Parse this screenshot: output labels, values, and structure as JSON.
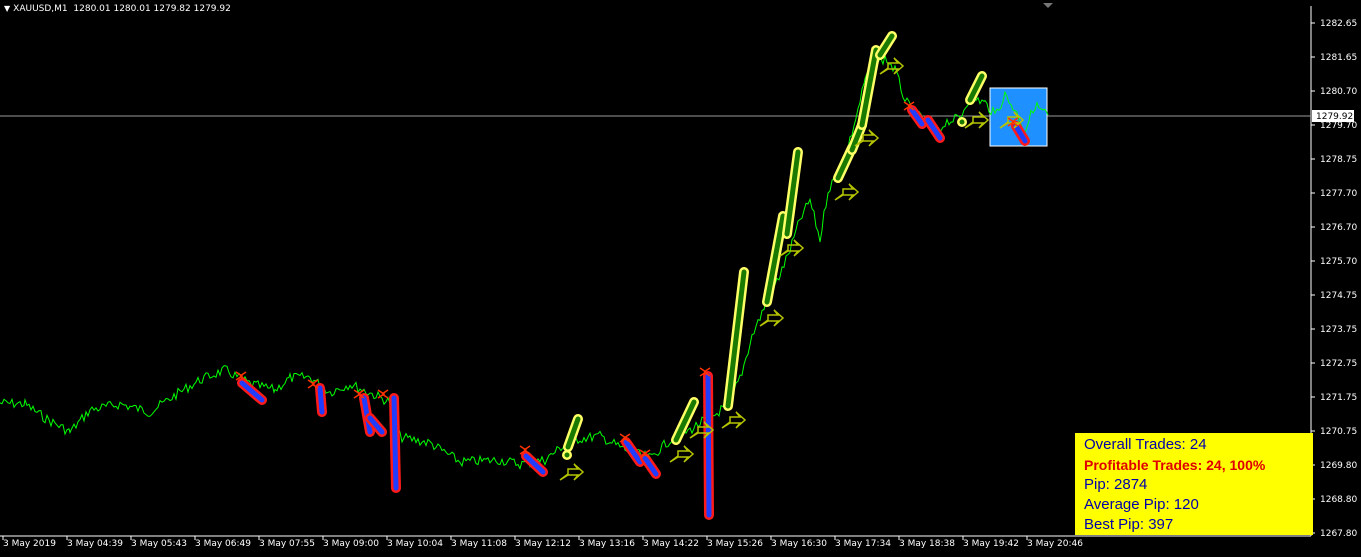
{
  "symbol": {
    "label": "XAUUSD,M1",
    "ohlc": "1280.01 1280.01 1279.82 1279.92"
  },
  "price_axis": {
    "ticks": [
      "1282.65",
      "1281.65",
      "1280.70",
      "1279.70",
      "1278.75",
      "1277.70",
      "1276.70",
      "1275.70",
      "1274.75",
      "1273.75",
      "1272.75",
      "1271.75",
      "1270.75",
      "1269.80",
      "1268.80",
      "1267.80"
    ],
    "current_price": "1279.92"
  },
  "time_axis": {
    "ticks": [
      "3 May 2019",
      "3 May 04:39",
      "3 May 05:43",
      "3 May 06:49",
      "3 May 07:55",
      "3 May 09:00",
      "3 May 10:04",
      "3 May 11:08",
      "3 May 12:12",
      "3 May 13:16",
      "3 May 14:22",
      "3 May 15:26",
      "3 May 16:30",
      "3 May 17:34",
      "3 May 18:38",
      "3 May 19:42",
      "3 May 20:46"
    ]
  },
  "stats": {
    "overall": "Overall Trades: 24",
    "profitable": "Profitable Trades: 24, 100%",
    "pip": "Pip: 2874",
    "average": "Average Pip: 120",
    "best": "Best Pip: 397"
  },
  "colors": {
    "background": "#000000",
    "price_line": "#00ff00",
    "axis": "#ffffff",
    "buy_fill": "#1a7a00",
    "buy_outline": "#ffff66",
    "sell_fill": "#1f3cff",
    "sell_outline": "#ff1a1a",
    "arrow_buy": "#b5c400",
    "arrow_sell": "#ff3300",
    "box": "#1e90ff",
    "panel": "#ffff00",
    "panel_text": "#0000aa",
    "panel_highlight": "#e00000"
  }
}
